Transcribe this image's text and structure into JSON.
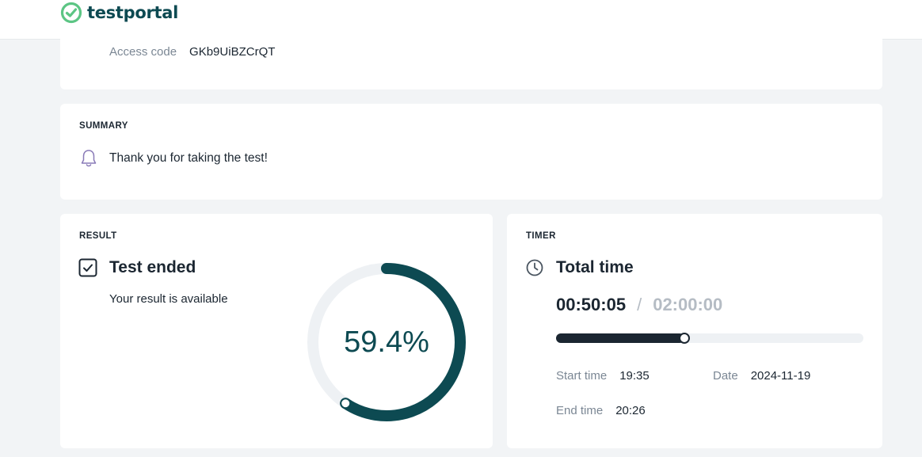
{
  "brand": {
    "name": "testportal",
    "color": "#0d4a52",
    "mark_color": "#5cc584"
  },
  "access": {
    "label": "Access code",
    "value": "GKb9UiBZCrQT"
  },
  "summary": {
    "section_label": "SUMMARY",
    "message": "Thank you for taking the test!",
    "icon": "bell-icon"
  },
  "result": {
    "section_label": "RESULT",
    "title": "Test ended",
    "subtitle": "Your result is available",
    "icon": "checkbox-checked-icon",
    "score_text": "59.4%",
    "score_fraction": 0.594,
    "ring_color": "#0d4a52",
    "ring_track_color": "#eef1f4"
  },
  "timer": {
    "section_label": "TIMER",
    "title": "Total time",
    "icon": "clock-icon",
    "elapsed": "00:50:05",
    "separator": "/",
    "limit": "02:00:00",
    "progress_fraction": 0.4173,
    "start_label": "Start time",
    "start_value": "19:35",
    "date_label": "Date",
    "date_value": "2024-11-19",
    "end_label": "End time",
    "end_value": "20:26"
  }
}
